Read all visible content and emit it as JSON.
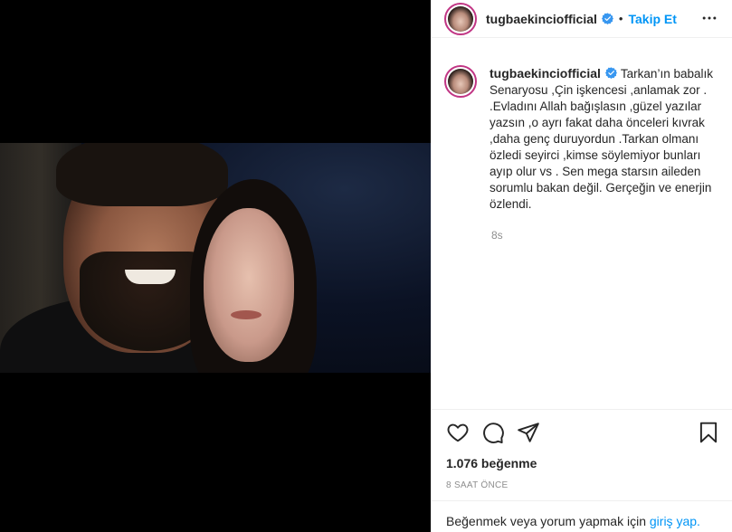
{
  "post": {
    "username": "tugbaekinciofficial",
    "follow_label": "Takip Et",
    "separator": "•",
    "caption": "Tarkan’ın babalık Senaryosu ,Çin işkencesi ,anlamak zor . .Evladını Allah bağışlasın ,güzel yazılar yazsın ,o ayrı fakat daha önceleri kıvrak ,daha genç duruyordun .Tarkan olmanı özledi seyirci ,kimse söylemiyor bunları ayıp olur vs . Sen mega starsın aileden sorumlu bakan değil. Gerçeğin ve enerjin özlendi.",
    "caption_time": "8s",
    "likes": "1.076 beğenme",
    "date": "8 SAAT ÖNCE",
    "login_prompt": "Beğenmek veya yorum yapmak için",
    "login_link": "giriş yap."
  },
  "icons": {
    "verified": "verified-badge-icon",
    "more": "more-options-icon",
    "like": "heart-icon",
    "comment": "comment-icon",
    "share": "share-icon",
    "save": "bookmark-icon"
  },
  "colors": {
    "accent": "#0095f6",
    "text": "#262626",
    "muted": "#8e8e8e",
    "border": "#efefef"
  }
}
